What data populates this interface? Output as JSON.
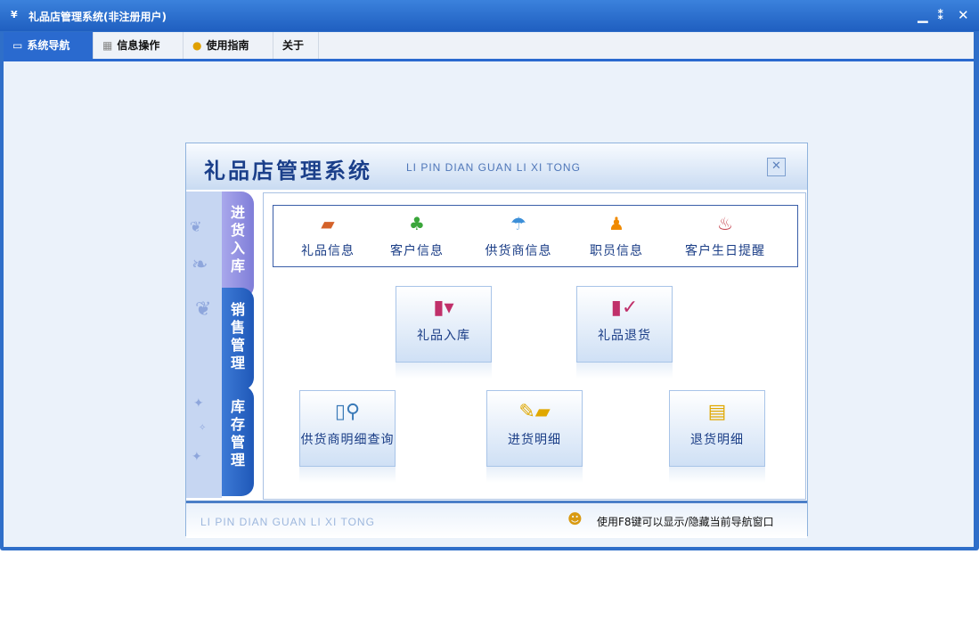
{
  "window": {
    "app_icon": "¥",
    "title": "礼品店管理系统(非注册用户)",
    "controls": {
      "minimize": "▁",
      "restore": "⁑",
      "close": "✕"
    }
  },
  "menubar": {
    "tabs": [
      {
        "label": "系统导航",
        "icon": "monitor-icon"
      },
      {
        "label": "信息操作",
        "icon": "grid-icon"
      },
      {
        "label": "使用指南",
        "icon": "help-icon"
      },
      {
        "label": "关于"
      }
    ],
    "active_index": 0
  },
  "nav_panel": {
    "title": "礼品店管理系统",
    "subtitle": "LI PIN DIAN GUAN LI XI TONG",
    "side_tabs": [
      {
        "label": "进货入库",
        "chars": [
          "进",
          "货",
          "入",
          "库"
        ]
      },
      {
        "label": "销售管理",
        "chars": [
          "销",
          "售",
          "管",
          "理"
        ]
      },
      {
        "label": "库存管理",
        "chars": [
          "库",
          "存",
          "管",
          "理"
        ]
      }
    ],
    "active_side_tab": 0,
    "quick_links": [
      {
        "label": "礼品信息",
        "icon": "gift-folder-icon"
      },
      {
        "label": "客户信息",
        "icon": "customers-icon"
      },
      {
        "label": "供货商信息",
        "icon": "supplier-icon"
      },
      {
        "label": "职员信息",
        "icon": "staff-icon"
      },
      {
        "label": "客户生日提醒",
        "icon": "birthday-cake-icon"
      }
    ],
    "tiles": [
      {
        "label": "礼品入库",
        "icon": "stock-in-icon"
      },
      {
        "label": "礼品退货",
        "icon": "return-goods-icon"
      },
      {
        "label": "供货商明细查询",
        "icon": "search-detail-icon"
      },
      {
        "label": "进货明细",
        "icon": "purchase-detail-icon"
      },
      {
        "label": "退货明细",
        "icon": "return-detail-icon"
      }
    ],
    "footer": {
      "subtitle": "LI PIN DIAN GUAN LI XI TONG",
      "hint": "使用F8键可以显示/隐藏当前导航窗口"
    }
  },
  "colors": {
    "titlebar": "#1f5fc0",
    "accent": "#2a6acf",
    "side_tab_active": "#8f8ee0",
    "side_tab": "#2f6cc8",
    "label_text": "#1a3d86"
  }
}
